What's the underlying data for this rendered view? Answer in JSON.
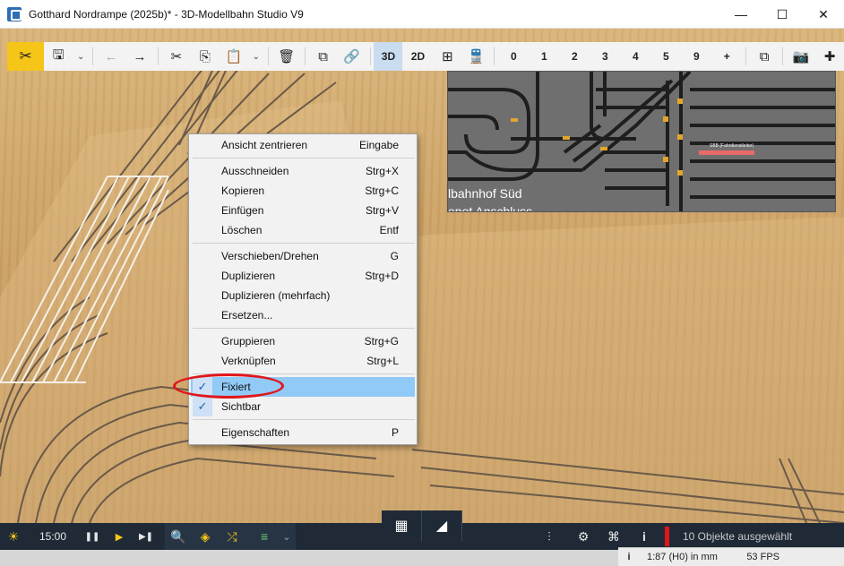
{
  "window": {
    "title": "Gotthard Nordrampe (2025b)* - 3D-Modellbahn Studio V9",
    "minimize": "—",
    "maximize": "☐",
    "close": "✕"
  },
  "toolbar": {
    "tools_icon": "✂",
    "save_icon": "🖫",
    "chevron": "⌄",
    "undo_icon": "←",
    "redo_icon": "→",
    "cut_icon": "✂",
    "copy_icon": "⎘",
    "paste_icon": "📋",
    "delete_icon": "🗑",
    "group_icon": "⧉",
    "link_icon": "🔗",
    "view_3d": "3D",
    "view_2d": "2D",
    "grid_icon": "⊞",
    "train_icon": "🚆",
    "views": [
      "0",
      "1",
      "2",
      "3",
      "4",
      "5",
      "9"
    ],
    "add_icon": "+",
    "window_icon": "⧉",
    "camera_icon": "📷",
    "plugin_icon": "✚"
  },
  "overlay": {
    "label1": "lbahnhof Süd",
    "label2": "epot Anschluss",
    "sign": "SBB (Fahrdienstleiter)"
  },
  "context_menu": {
    "items": [
      {
        "label": "Ansicht zentrieren",
        "shortcut": "Eingabe"
      },
      {
        "label": "Ausschneiden",
        "shortcut": "Strg+X"
      },
      {
        "label": "Kopieren",
        "shortcut": "Strg+C"
      },
      {
        "label": "Einfügen",
        "shortcut": "Strg+V"
      },
      {
        "label": "Löschen",
        "shortcut": "Entf"
      },
      {
        "label": "Verschieben/Drehen",
        "shortcut": "G"
      },
      {
        "label": "Duplizieren",
        "shortcut": "Strg+D"
      },
      {
        "label": "Duplizieren (mehrfach)",
        "shortcut": ""
      },
      {
        "label": "Ersetzen...",
        "shortcut": ""
      },
      {
        "label": "Gruppieren",
        "shortcut": "Strg+G"
      },
      {
        "label": "Verknüpfen",
        "shortcut": "Strg+L"
      },
      {
        "label": "Fixiert",
        "shortcut": "",
        "checked": true,
        "highlighted": true
      },
      {
        "label": "Sichtbar",
        "shortcut": "",
        "checked": true
      },
      {
        "label": "Eigenschaften",
        "shortcut": "P"
      }
    ],
    "check_mark": "✓"
  },
  "bottombar": {
    "sun_icon": "☀",
    "time": "15:00",
    "pause_icon": "❚❚",
    "play_icon": "▶",
    "step_icon": "▶❚",
    "search_icon": "🔍",
    "layers_icon": "◈",
    "shuffle_icon": "⤮",
    "list_icon": "≡",
    "chevron": "⌄",
    "mixer_icon": "⫶",
    "gear_icon": "⚙",
    "network_icon": "⌘",
    "info_icon": "i",
    "status": "10 Objekte ausgewählt",
    "view_grid_icon": "▦",
    "view_terrain_icon": "◢"
  },
  "statusstrip": {
    "info": "i",
    "scale": "1:87 (H0) in mm",
    "fps": "53 FPS"
  },
  "colors": {
    "accent": "#f5c518",
    "highlight": "#91c9f7",
    "red_ring": "#e0161b",
    "bottom_bar": "#1f2a36"
  }
}
